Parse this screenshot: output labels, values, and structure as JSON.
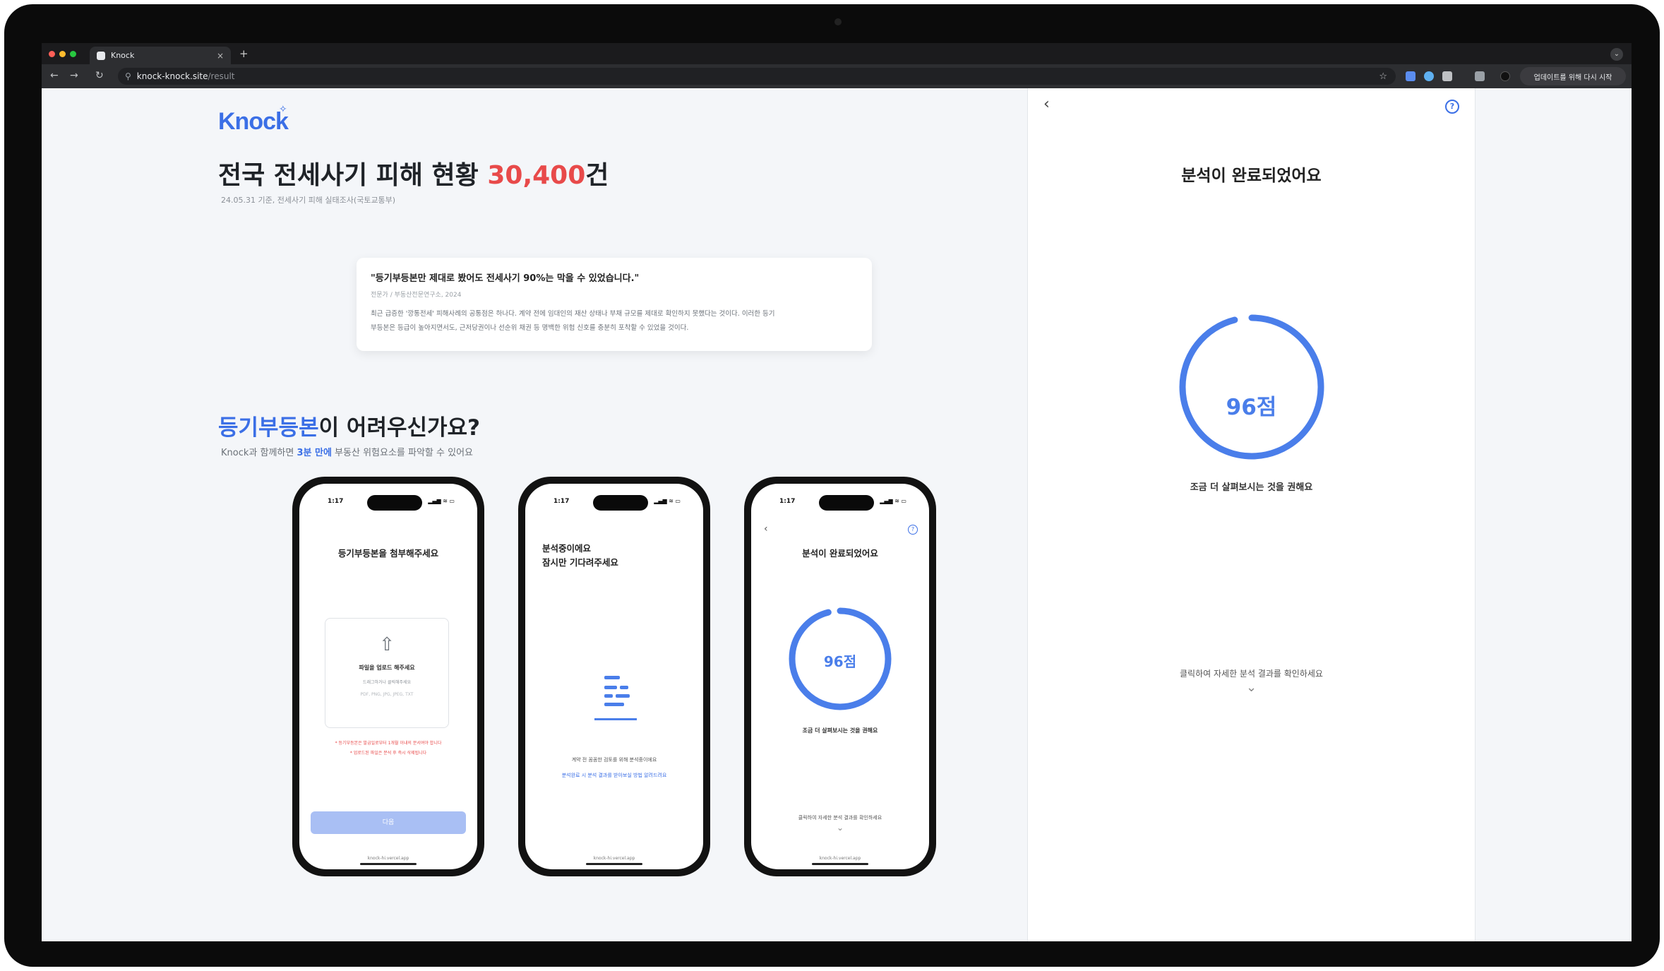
{
  "browser": {
    "tab_title": "Knock",
    "tab_close": "×",
    "new_tab": "+",
    "url_host": "knock-knock.site",
    "url_path": "/result",
    "relaunch_label": "업데이트를 위해 다시 시작",
    "nav_back": "←",
    "nav_forward": "→",
    "nav_reload": "↻",
    "star": "☆"
  },
  "landing": {
    "logo": "Knock",
    "logo_sparkle": "✧",
    "headline_prefix": "전국 전세사기 피해 현황 ",
    "headline_number": "30,400",
    "headline_suffix": "건",
    "headline_source": "24.05.31 기준, 전세사기 피해 실태조사(국토교통부)",
    "quote": {
      "title": "\"등기부등본만 제대로 봤어도 전세사기 90%는 막을 수 있었습니다.\"",
      "source": "전문가 / 부동산전문연구소, 2024",
      "body_line1": "최근 급증한 '깡통전세' 피해사례의 공통점은 하나다. 계약 전에 임대인의 재산 상태나 부채 규모를 제대로 확인하지 못했다는 것이다. 이러한 등기",
      "body_line2": "부등본은 등급이 높아지면서도, 근저당권이나 선순위 채권 등 명백한 위험 신호를 충분히 포착할 수 있었을 것이다."
    },
    "sub_heading_highlight": "등기부등본",
    "sub_heading_rest": "이 어려우신가요?",
    "sub_text_prefix": "Knock과 함께하면 ",
    "sub_text_highlight": "3분 만에",
    "sub_text_suffix": " 부동산 위험요소를 파악할 수 있어요"
  },
  "phones": {
    "time": "1:17",
    "status": "▂▄▆ ≋ ▭",
    "footer": "knock-hi.vercel.app",
    "phone1": {
      "title": "등기부등본을 첨부해주세요",
      "upload_icon": "⇧",
      "upload_main": "파일을 업로드 해주세요",
      "upload_sub": "드래그하거나 클릭해주세요",
      "upload_formats": "PDF, PNG, JPG, JPEG, TXT",
      "warning_line1": "* 등기부등본은 발급일로부터 1개월 이내의 문서여야 합니다",
      "warning_line2": "* 업로드된 파일은 분석 후 즉시 삭제됩니다",
      "next_button": "다음"
    },
    "phone2": {
      "title_line1": "분석중이에요",
      "title_line2": "잠시만 기다려주세요",
      "note": "계약 전 꼼꼼한 검토를 위해 분석중이에요",
      "link": "분석완료 시 분석 결과를 받아보실 방법 알려드려요"
    },
    "phone3": {
      "back": "‹",
      "help": "?",
      "title": "분석이 완료되었어요",
      "score": "96점",
      "caption": "조금 더 살펴보시는 것을 권해요",
      "click_hint": "클릭하여 자세한 분석 결과를 확인하세요",
      "chevron": "⌄"
    }
  },
  "result_panel": {
    "back": "‹",
    "help": "?",
    "title": "분석이 완료되었어요",
    "score_label": "96점",
    "score_value": 96,
    "score_max": 100,
    "caption": "조금 더 살펴보시는 것을 권해요",
    "click_hint": "클릭하여 자세한 분석 결과를 확인하세요",
    "chevron": "⌄"
  },
  "colors": {
    "accent": "#3b6fe6",
    "score_ring": "#4a7eea",
    "danger": "#e84a4a"
  }
}
